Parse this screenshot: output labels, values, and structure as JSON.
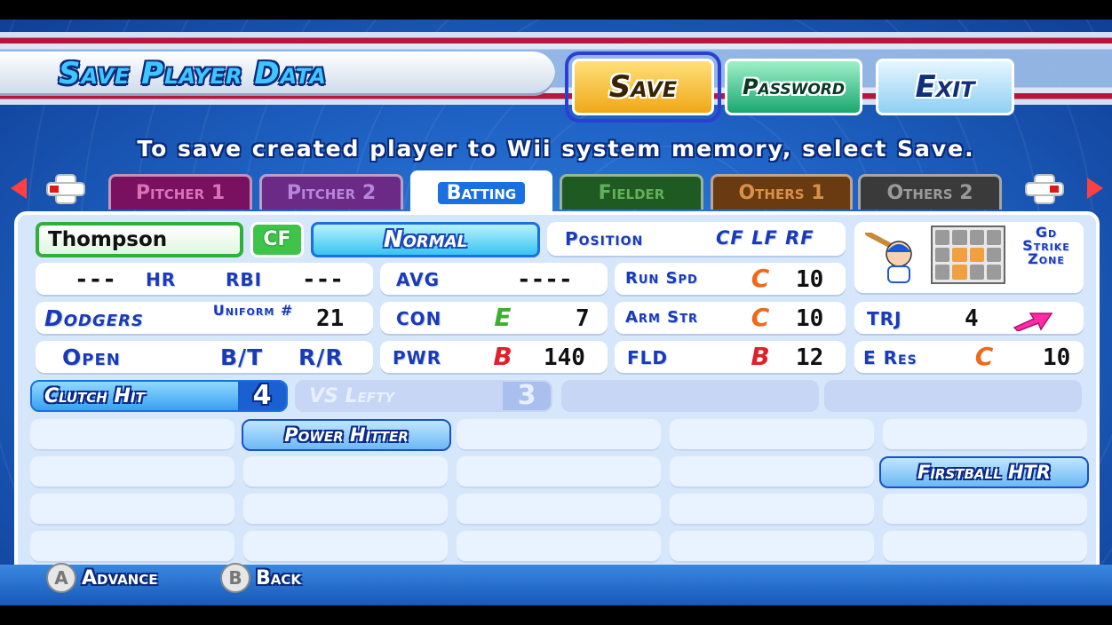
{
  "header": {
    "title": "Save Player Data",
    "buttons": {
      "save": "Save",
      "password": "Password",
      "exit": "Exit"
    }
  },
  "instruction": "To save created player to Wii system memory, select Save.",
  "tabs": [
    {
      "id": "pitcher1",
      "label": "Pitcher 1"
    },
    {
      "id": "pitcher2",
      "label": "Pitcher 2"
    },
    {
      "id": "batting",
      "label": "Batting",
      "active": true
    },
    {
      "id": "fielder",
      "label": "Fielder"
    },
    {
      "id": "others1",
      "label": "Others 1"
    },
    {
      "id": "others2",
      "label": "Others 2"
    }
  ],
  "player": {
    "name": "Thompson",
    "pos": "CF",
    "style": "Normal",
    "position_label": "Position",
    "positions": "CF LF RF",
    "hr_label": "HR",
    "hr_value": "---",
    "rbi_label": "RBI",
    "rbi_value": "---",
    "avg_label": "AVG",
    "avg_value": "----",
    "run_spd_label": "Run Spd",
    "run_spd_grade": "C",
    "run_spd_value": "10",
    "team": "Dodgers",
    "uniform_label": "Uniform #",
    "uniform_value": "21",
    "con_label": "CON",
    "con_grade": "E",
    "con_value": "7",
    "arm_label": "Arm Str",
    "arm_grade": "C",
    "arm_value": "10",
    "trj_label": "TRJ",
    "trj_value": "4",
    "stance": "Open",
    "bt_label": "B/T",
    "bt_value": "R/R",
    "pwr_label": "PWR",
    "pwr_grade": "B",
    "pwr_value": "140",
    "fld_label": "FLD",
    "fld_grade": "B",
    "fld_value": "12",
    "eres_label": "E Res",
    "eres_grade": "C",
    "eres_value": "10",
    "zone_label": "Gd Strike Zone"
  },
  "skills": [
    {
      "name": "Clutch Hit",
      "level": "4",
      "active": true
    },
    {
      "name": "VS Lefty",
      "level": "3",
      "active": false
    }
  ],
  "abilities": {
    "power_hitter": "Power Hitter",
    "firstball": "Firstball HTR"
  },
  "footer": {
    "a_key": "A",
    "a_label": "Advance",
    "b_key": "B",
    "b_label": "Back"
  }
}
